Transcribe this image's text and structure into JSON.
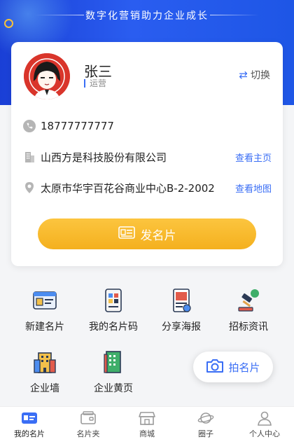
{
  "banner": {
    "slogan": "数字化营销助力企业成长"
  },
  "profile": {
    "name": "张三",
    "role": "运营",
    "switch_label": "切换",
    "phone": "18777777777",
    "company": "山西方是科技股份有限公司",
    "company_link": "查看主页",
    "address": "太原市华宇百花谷商业中心B-2-2002",
    "address_link": "查看地图",
    "send_button": "发名片"
  },
  "features": [
    {
      "label": "新建名片",
      "icon": "new-card-icon"
    },
    {
      "label": "我的名片码",
      "icon": "qr-card-icon"
    },
    {
      "label": "分享海报",
      "icon": "poster-icon"
    },
    {
      "label": "招标资讯",
      "icon": "bid-hammer-icon"
    },
    {
      "label": "企业墙",
      "icon": "company-wall-icon"
    },
    {
      "label": "企业黄页",
      "icon": "yellow-pages-icon"
    }
  ],
  "snap_button": "拍名片",
  "tabs": [
    {
      "label": "我的名片",
      "icon": "my-card-icon",
      "active": true
    },
    {
      "label": "名片夹",
      "icon": "card-holder-icon",
      "active": false
    },
    {
      "label": "商城",
      "icon": "shop-icon",
      "active": false
    },
    {
      "label": "圈子",
      "icon": "planet-icon",
      "active": false
    },
    {
      "label": "个人中心",
      "icon": "user-icon",
      "active": false
    }
  ],
  "colors": {
    "primary": "#3a6ef5",
    "accent": "#f7b526",
    "banner": "#2050e8"
  }
}
